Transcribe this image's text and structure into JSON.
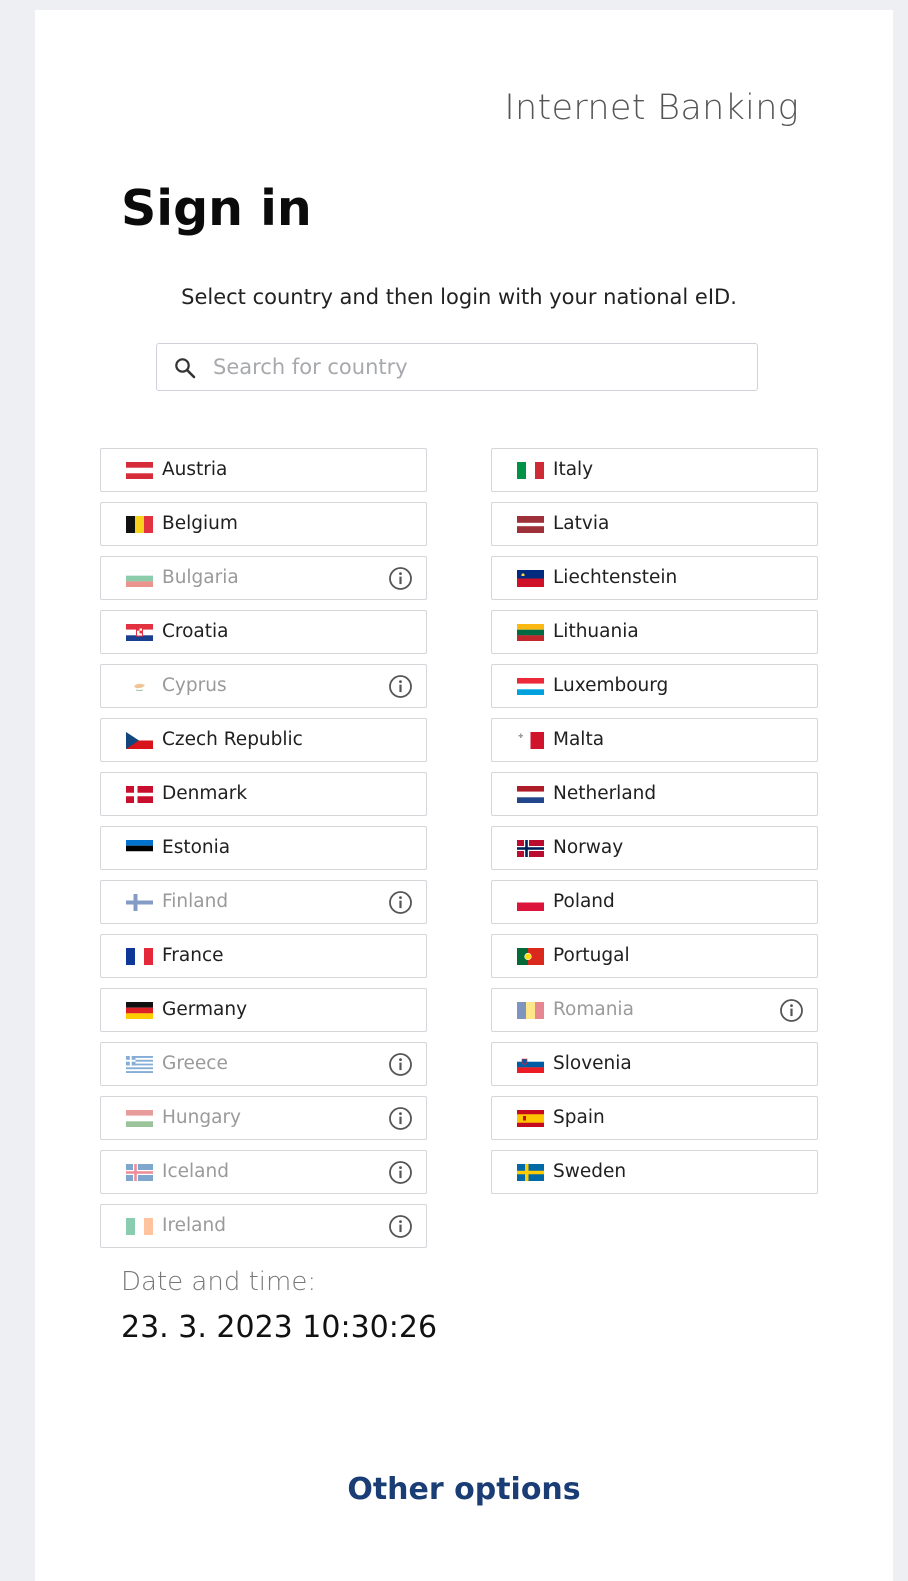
{
  "header": {
    "title": "Internet Banking"
  },
  "page_title": "Sign in",
  "subtitle": "Select country and then login with your national eID.",
  "search": {
    "placeholder": "Search for country",
    "value": ""
  },
  "countries_left": [
    {
      "name": "Austria",
      "flag": "flag-austria",
      "disabled": false
    },
    {
      "name": "Belgium",
      "flag": "flag-belgium",
      "disabled": false
    },
    {
      "name": "Bulgaria",
      "flag": "flag-bulgaria",
      "disabled": true
    },
    {
      "name": "Croatia",
      "flag": "flag-croatia",
      "disabled": false
    },
    {
      "name": "Cyprus",
      "flag": "flag-cyprus",
      "disabled": true
    },
    {
      "name": "Czech Republic",
      "flag": "flag-czech-republic",
      "disabled": false
    },
    {
      "name": "Denmark",
      "flag": "flag-denmark",
      "disabled": false
    },
    {
      "name": "Estonia",
      "flag": "flag-estonia",
      "disabled": false
    },
    {
      "name": "Finland",
      "flag": "flag-finland",
      "disabled": true
    },
    {
      "name": "France",
      "flag": "flag-france",
      "disabled": false
    },
    {
      "name": "Germany",
      "flag": "flag-germany",
      "disabled": false
    },
    {
      "name": "Greece",
      "flag": "flag-greece",
      "disabled": true
    },
    {
      "name": "Hungary",
      "flag": "flag-hungary",
      "disabled": true
    },
    {
      "name": "Iceland",
      "flag": "flag-iceland",
      "disabled": true
    },
    {
      "name": "Ireland",
      "flag": "flag-ireland",
      "disabled": true
    }
  ],
  "countries_right": [
    {
      "name": "Italy",
      "flag": "flag-italy",
      "disabled": false
    },
    {
      "name": "Latvia",
      "flag": "flag-latvia",
      "disabled": false
    },
    {
      "name": "Liechtenstein",
      "flag": "flag-liechtenstein",
      "disabled": false
    },
    {
      "name": "Lithuania",
      "flag": "flag-lithuania",
      "disabled": false
    },
    {
      "name": "Luxembourg",
      "flag": "flag-luxembourg",
      "disabled": false
    },
    {
      "name": "Malta",
      "flag": "flag-malta",
      "disabled": false
    },
    {
      "name": "Netherland",
      "flag": "flag-netherlands",
      "disabled": false
    },
    {
      "name": "Norway",
      "flag": "flag-norway",
      "disabled": false
    },
    {
      "name": "Poland",
      "flag": "flag-poland",
      "disabled": false
    },
    {
      "name": "Portugal",
      "flag": "flag-portugal",
      "disabled": false
    },
    {
      "name": "Romania",
      "flag": "flag-romania",
      "disabled": true
    },
    {
      "name": "Slovenia",
      "flag": "flag-slovenia",
      "disabled": false
    },
    {
      "name": "Spain",
      "flag": "flag-spain",
      "disabled": false
    },
    {
      "name": "Sweden",
      "flag": "flag-sweden",
      "disabled": false
    }
  ],
  "datetime": {
    "label": "Date and time:",
    "value": "23. 3. 2023 10:30:26"
  },
  "other_options": "Other options",
  "colors": {
    "link": "#1b3d75",
    "disabled_text": "#9a9a9a",
    "border": "#d4d6da"
  },
  "icons": {
    "search": "search-icon",
    "info": "info-icon"
  }
}
